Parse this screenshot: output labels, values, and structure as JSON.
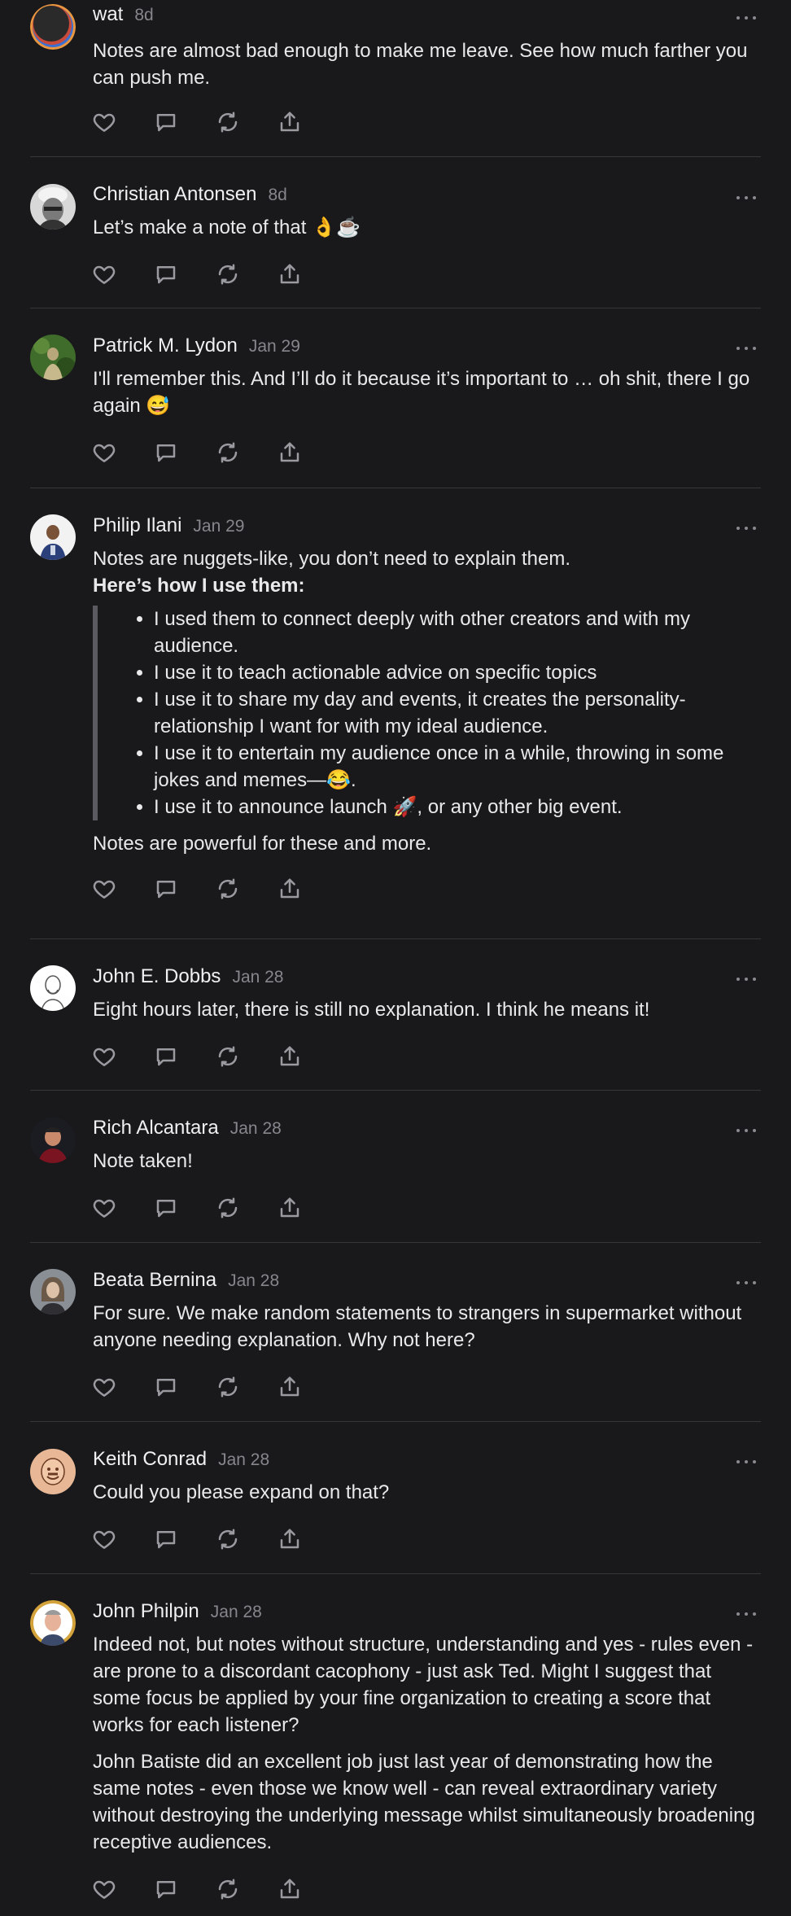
{
  "notes": [
    {
      "author": "wat",
      "date": "8d",
      "paragraphs": [
        "Notes are almost bad enough to make me leave. See how much farther you can push me."
      ],
      "avatar_colors": [
        "#2a2a2a",
        "#e89640"
      ]
    },
    {
      "author": "Christian Antonsen",
      "date": "8d",
      "paragraphs": [
        "Let’s make a note of that 👌☕"
      ],
      "avatar_colors": [
        "#666666",
        "#d8d8d8"
      ]
    },
    {
      "author": "Patrick M. Lydon",
      "date": "Jan 29",
      "paragraphs": [
        "I'll remember this. And I’ll do it because it’s important to … oh shit, there I go again 😅"
      ],
      "avatar_colors": [
        "#3f6b2b",
        "#b8a77a"
      ]
    },
    {
      "author": "Philip Ilani",
      "date": "Jan 29",
      "paragraphs": [
        "Notes are nuggets-like, you don’t need to explain them."
      ],
      "bold_heading": "Here’s how I use them:",
      "list": [
        "I used them to connect deeply with other creators and with my audience.",
        "I use it to teach actionable advice on specific topics",
        "I use it to share my day and events, it creates the personality-relationship I want for with my ideal audience.",
        "I use it to entertain my audience once in a while, throwing in some jokes and memes—😂.",
        "I use it to announce launch 🚀, or any other big event."
      ],
      "closing": "Notes are powerful for these and more.",
      "avatar_colors": [
        "#f2f2f2",
        "#2b3f7a"
      ]
    },
    {
      "author": "John E. Dobbs",
      "date": "Jan 28",
      "paragraphs": [
        "Eight hours later, there is still no explanation. I think he means it!"
      ],
      "avatar_colors": [
        "#ffffff",
        "#555555"
      ]
    },
    {
      "author": "Rich Alcantara",
      "date": "Jan 28",
      "paragraphs": [
        "Note taken!"
      ],
      "avatar_colors": [
        "#7a1420",
        "#c98a6c"
      ]
    },
    {
      "author": "Beata Bernina",
      "date": "Jan 28",
      "paragraphs": [
        "For sure. We make random statements to strangers in supermarket without anyone needing explanation. Why not here?"
      ],
      "avatar_colors": [
        "#8a8f96",
        "#6b5a4a"
      ]
    },
    {
      "author": "Keith Conrad",
      "date": "Jan 28",
      "paragraphs": [
        "Could you please expand on that?"
      ],
      "avatar_colors": [
        "#e8b896",
        "#6a3a22"
      ]
    },
    {
      "author": "John Philpin",
      "date": "Jan 28",
      "paragraphs": [
        "Indeed not, but notes without structure, understanding and yes - rules even - are prone to a discordant cacophony - just ask Ted. Might I suggest that some focus be applied by your fine organization to creating a score that works for each listener?",
        "John Batiste did an excellent job just last year of demonstrating how the same notes - even those we know well - can reveal extraordinary variety without destroying the underlying message whilst simultaneously broadening receptive audiences."
      ],
      "avatar_colors": [
        "#d4a23a",
        "#e6b39a"
      ]
    }
  ]
}
